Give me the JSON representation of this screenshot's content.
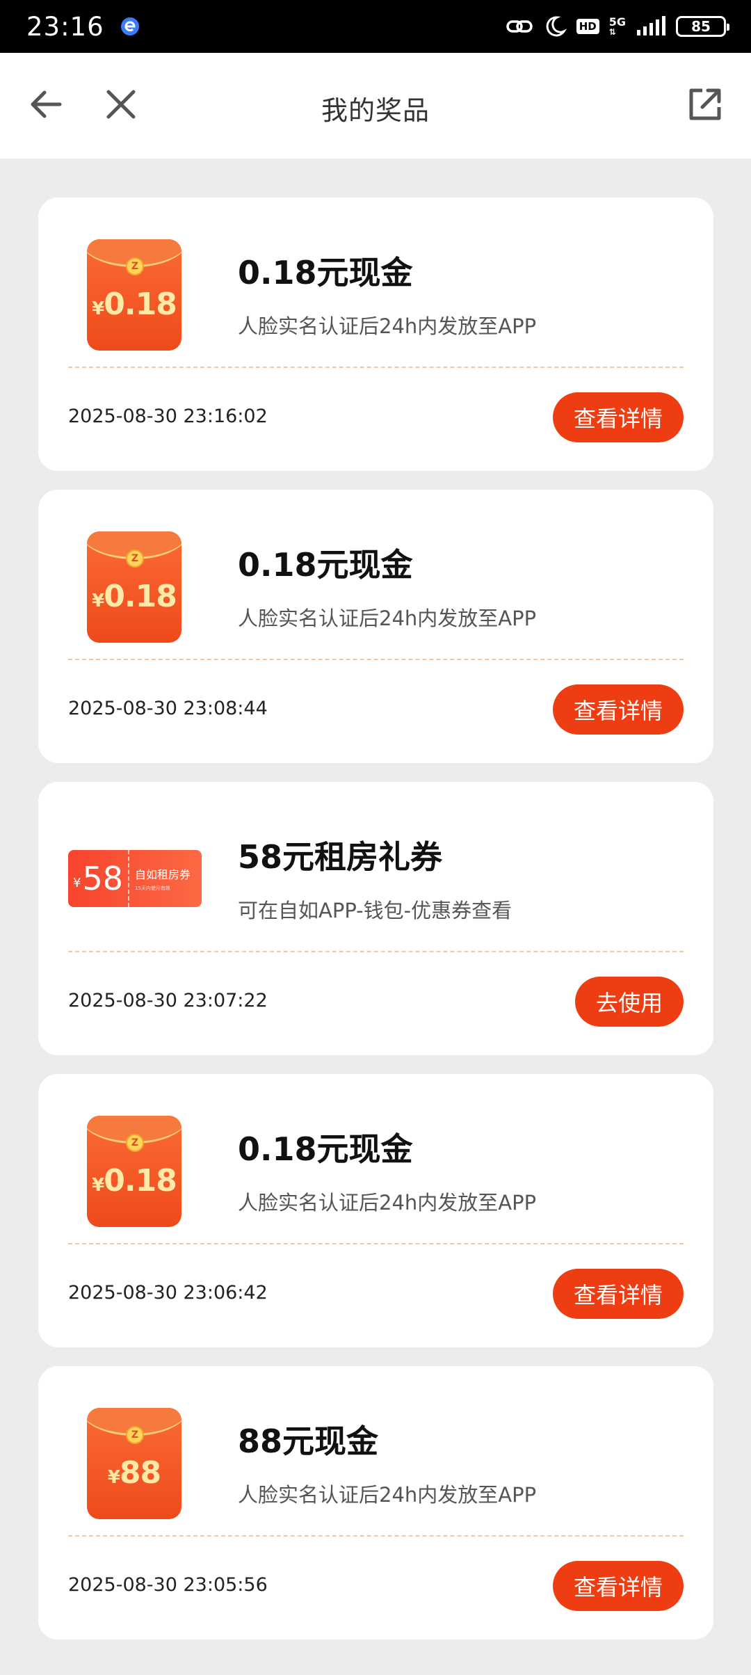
{
  "status_bar": {
    "time": "23:16",
    "network": "5G",
    "hd": "HD",
    "battery": "85"
  },
  "header": {
    "title": "我的奖品"
  },
  "prizes": [
    {
      "title": "0.18元现金",
      "desc": "人脸实名认证后24h内发放至APP",
      "time": "2025-08-30 23:16:02",
      "button": "查看详情",
      "icon": {
        "type": "red-envelope",
        "yen": "¥",
        "amount": "0.18",
        "coin": "Z"
      }
    },
    {
      "title": "0.18元现金",
      "desc": "人脸实名认证后24h内发放至APP",
      "time": "2025-08-30 23:08:44",
      "button": "查看详情",
      "icon": {
        "type": "red-envelope",
        "yen": "¥",
        "amount": "0.18",
        "coin": "Z"
      }
    },
    {
      "title": "58元租房礼券",
      "desc": "可在自如APP-钱包-优惠券查看",
      "time": "2025-08-30 23:07:22",
      "button": "去使用",
      "icon": {
        "type": "coupon",
        "yen": "¥",
        "amount": "58",
        "name": "自如租房券",
        "sub": "15天内使用有效"
      }
    },
    {
      "title": "0.18元现金",
      "desc": "人脸实名认证后24h内发放至APP",
      "time": "2025-08-30 23:06:42",
      "button": "查看详情",
      "icon": {
        "type": "red-envelope",
        "yen": "¥",
        "amount": "0.18",
        "coin": "Z"
      }
    },
    {
      "title": "88元现金",
      "desc": "人脸实名认证后24h内发放至APP",
      "time": "2025-08-30 23:05:56",
      "button": "查看详情",
      "icon": {
        "type": "red-envelope",
        "yen": "¥",
        "amount": "88",
        "coin": "Z"
      }
    }
  ],
  "colors": {
    "accent": "#ee3d12",
    "background": "#ececec"
  }
}
